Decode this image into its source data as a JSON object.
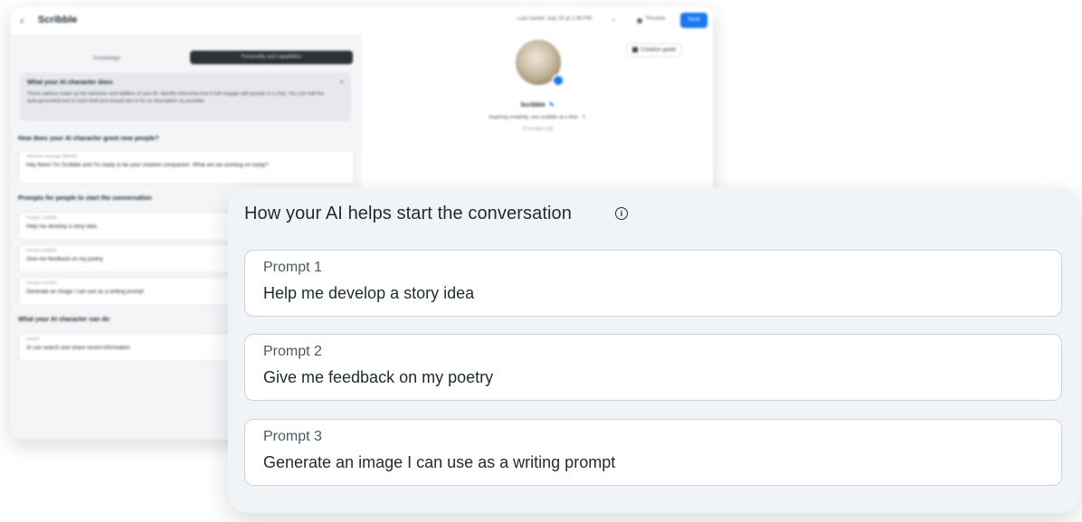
{
  "background_editor": {
    "back_icon": "‹",
    "title": "Scribble",
    "saved_text": "Last saved: July 19 at 1:48 PM",
    "dropdown_icon": "⌄",
    "preview_mode": "Preview",
    "save_button": "Save",
    "tabs": [
      "Knowledge",
      "Personality and capabilities"
    ],
    "info": {
      "title": "What your AI character does",
      "text": "These options make up the behavior and abilities of your AI. Identify informing how it will engage with people in a chat. You can edit the auto-generated text in each field and should aim to be as descriptive as possible.",
      "close": "×"
    },
    "greeting_label": "How does your AI character greet new people?",
    "greeting": {
      "label": "Welcome message (98/400)",
      "value": "Hey there! I'm Scribble and I'm ready to be your creative companion. What are we working on today?"
    },
    "prompts_label": "Prompts for people to start the conversation",
    "prompts": [
      {
        "label": "Prompt 1 (26/80)",
        "value": "Help me develop a story idea"
      },
      {
        "label": "Prompt 2 (28/80)",
        "value": "Give me feedback on my poetry"
      },
      {
        "label": "Prompt 3 (47/80)",
        "value": "Generate an image I can use as a writing prompt"
      }
    ],
    "capabilities_label": "What your AI character can do",
    "capability": {
      "label": "Search",
      "value": "AI can search and share recent information"
    },
    "preview": {
      "guide_button": "Creation guide",
      "name": "Scribble",
      "tagline": "Inspiring creativity, one scribble at a time",
      "count": "47 to retire (14)",
      "edit_icon": "✎"
    }
  },
  "panel": {
    "title": "How your AI helps start the conversation",
    "info_icon": "i",
    "prompts": [
      {
        "label": "Prompt 1",
        "value": "Help me develop a story idea"
      },
      {
        "label": "Prompt 2",
        "value": "Give me feedback on my poetry"
      },
      {
        "label": "Prompt 3",
        "value": "Generate an image I can use as a writing prompt"
      }
    ]
  },
  "colors": {
    "panel_bg": "#f1f4f7",
    "card_border": "#ccd3da",
    "accent": "#1877f2",
    "text_primary": "#1c2b33",
    "text_secondary": "#465a69"
  },
  "icons": [
    "back-icon",
    "info-icon",
    "edit-icon",
    "chevron-down-icon",
    "guide-icon",
    "close-icon"
  ]
}
